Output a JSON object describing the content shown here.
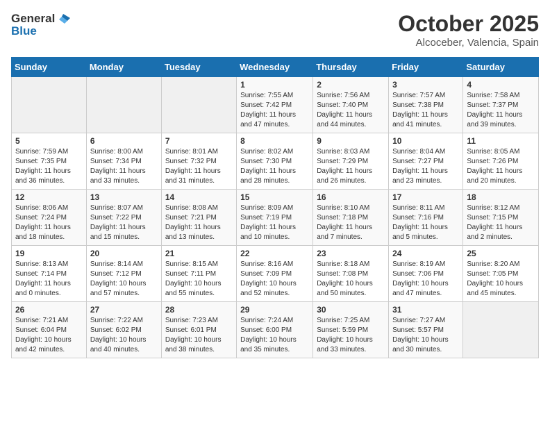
{
  "header": {
    "logo": {
      "text_general": "General",
      "text_blue": "Blue"
    },
    "title": "October 2025",
    "subtitle": "Alcoceber, Valencia, Spain"
  },
  "weekdays": [
    "Sunday",
    "Monday",
    "Tuesday",
    "Wednesday",
    "Thursday",
    "Friday",
    "Saturday"
  ],
  "weeks": [
    [
      {
        "day": "",
        "info": ""
      },
      {
        "day": "",
        "info": ""
      },
      {
        "day": "",
        "info": ""
      },
      {
        "day": "1",
        "info": "Sunrise: 7:55 AM\nSunset: 7:42 PM\nDaylight: 11 hours and 47 minutes."
      },
      {
        "day": "2",
        "info": "Sunrise: 7:56 AM\nSunset: 7:40 PM\nDaylight: 11 hours and 44 minutes."
      },
      {
        "day": "3",
        "info": "Sunrise: 7:57 AM\nSunset: 7:38 PM\nDaylight: 11 hours and 41 minutes."
      },
      {
        "day": "4",
        "info": "Sunrise: 7:58 AM\nSunset: 7:37 PM\nDaylight: 11 hours and 39 minutes."
      }
    ],
    [
      {
        "day": "5",
        "info": "Sunrise: 7:59 AM\nSunset: 7:35 PM\nDaylight: 11 hours and 36 minutes."
      },
      {
        "day": "6",
        "info": "Sunrise: 8:00 AM\nSunset: 7:34 PM\nDaylight: 11 hours and 33 minutes."
      },
      {
        "day": "7",
        "info": "Sunrise: 8:01 AM\nSunset: 7:32 PM\nDaylight: 11 hours and 31 minutes."
      },
      {
        "day": "8",
        "info": "Sunrise: 8:02 AM\nSunset: 7:30 PM\nDaylight: 11 hours and 28 minutes."
      },
      {
        "day": "9",
        "info": "Sunrise: 8:03 AM\nSunset: 7:29 PM\nDaylight: 11 hours and 26 minutes."
      },
      {
        "day": "10",
        "info": "Sunrise: 8:04 AM\nSunset: 7:27 PM\nDaylight: 11 hours and 23 minutes."
      },
      {
        "day": "11",
        "info": "Sunrise: 8:05 AM\nSunset: 7:26 PM\nDaylight: 11 hours and 20 minutes."
      }
    ],
    [
      {
        "day": "12",
        "info": "Sunrise: 8:06 AM\nSunset: 7:24 PM\nDaylight: 11 hours and 18 minutes."
      },
      {
        "day": "13",
        "info": "Sunrise: 8:07 AM\nSunset: 7:22 PM\nDaylight: 11 hours and 15 minutes."
      },
      {
        "day": "14",
        "info": "Sunrise: 8:08 AM\nSunset: 7:21 PM\nDaylight: 11 hours and 13 minutes."
      },
      {
        "day": "15",
        "info": "Sunrise: 8:09 AM\nSunset: 7:19 PM\nDaylight: 11 hours and 10 minutes."
      },
      {
        "day": "16",
        "info": "Sunrise: 8:10 AM\nSunset: 7:18 PM\nDaylight: 11 hours and 7 minutes."
      },
      {
        "day": "17",
        "info": "Sunrise: 8:11 AM\nSunset: 7:16 PM\nDaylight: 11 hours and 5 minutes."
      },
      {
        "day": "18",
        "info": "Sunrise: 8:12 AM\nSunset: 7:15 PM\nDaylight: 11 hours and 2 minutes."
      }
    ],
    [
      {
        "day": "19",
        "info": "Sunrise: 8:13 AM\nSunset: 7:14 PM\nDaylight: 11 hours and 0 minutes."
      },
      {
        "day": "20",
        "info": "Sunrise: 8:14 AM\nSunset: 7:12 PM\nDaylight: 10 hours and 57 minutes."
      },
      {
        "day": "21",
        "info": "Sunrise: 8:15 AM\nSunset: 7:11 PM\nDaylight: 10 hours and 55 minutes."
      },
      {
        "day": "22",
        "info": "Sunrise: 8:16 AM\nSunset: 7:09 PM\nDaylight: 10 hours and 52 minutes."
      },
      {
        "day": "23",
        "info": "Sunrise: 8:18 AM\nSunset: 7:08 PM\nDaylight: 10 hours and 50 minutes."
      },
      {
        "day": "24",
        "info": "Sunrise: 8:19 AM\nSunset: 7:06 PM\nDaylight: 10 hours and 47 minutes."
      },
      {
        "day": "25",
        "info": "Sunrise: 8:20 AM\nSunset: 7:05 PM\nDaylight: 10 hours and 45 minutes."
      }
    ],
    [
      {
        "day": "26",
        "info": "Sunrise: 7:21 AM\nSunset: 6:04 PM\nDaylight: 10 hours and 42 minutes."
      },
      {
        "day": "27",
        "info": "Sunrise: 7:22 AM\nSunset: 6:02 PM\nDaylight: 10 hours and 40 minutes."
      },
      {
        "day": "28",
        "info": "Sunrise: 7:23 AM\nSunset: 6:01 PM\nDaylight: 10 hours and 38 minutes."
      },
      {
        "day": "29",
        "info": "Sunrise: 7:24 AM\nSunset: 6:00 PM\nDaylight: 10 hours and 35 minutes."
      },
      {
        "day": "30",
        "info": "Sunrise: 7:25 AM\nSunset: 5:59 PM\nDaylight: 10 hours and 33 minutes."
      },
      {
        "day": "31",
        "info": "Sunrise: 7:27 AM\nSunset: 5:57 PM\nDaylight: 10 hours and 30 minutes."
      },
      {
        "day": "",
        "info": ""
      }
    ]
  ]
}
